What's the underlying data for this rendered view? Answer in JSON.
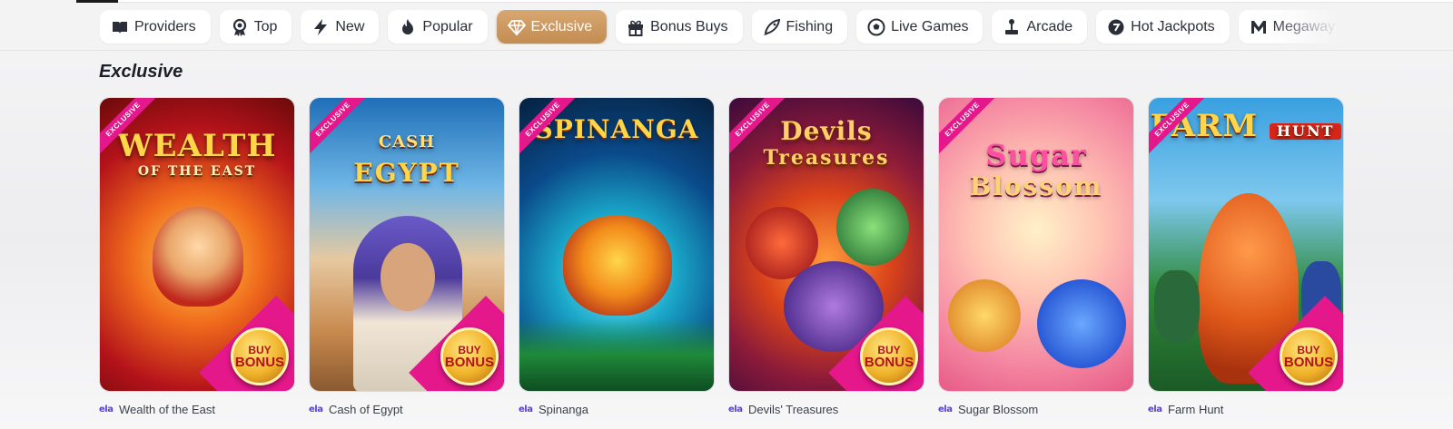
{
  "tabs": [
    {
      "label": "Providers",
      "icon": "book-icon"
    },
    {
      "label": "Top",
      "icon": "award-icon"
    },
    {
      "label": "New",
      "icon": "lightning-icon"
    },
    {
      "label": "Popular",
      "icon": "flame-icon"
    },
    {
      "label": "Exclusive",
      "icon": "diamond-icon",
      "active": true
    },
    {
      "label": "Bonus Buys",
      "icon": "gift-icon"
    },
    {
      "label": "Fishing",
      "icon": "fish-icon"
    },
    {
      "label": "Live Games",
      "icon": "soccer-ball-icon"
    },
    {
      "label": "Arcade",
      "icon": "joystick-icon"
    },
    {
      "label": "Hot Jackpots",
      "icon": "jackpot-icon"
    },
    {
      "label": "Megaway",
      "icon": "megaways-icon"
    }
  ],
  "section": {
    "title": "Exclusive"
  },
  "games": [
    {
      "name": "Wealth of the East",
      "logo": "WEALTH",
      "logo_sub": "OF THE EAST",
      "ribbon": "EXCLUSIVE",
      "badge_top": "BUY",
      "badge_bottom": "BONUS",
      "provider": "ela"
    },
    {
      "name": "Cash of Egypt",
      "logo": "CASH",
      "logo_sub": "EGYPT",
      "ribbon": "EXCLUSIVE",
      "badge_top": "BUY",
      "badge_bottom": "BONUS",
      "provider": "ela"
    },
    {
      "name": "Spinanga",
      "logo": "SPINANGA",
      "logo_sub": "",
      "ribbon": "EXCLUSIVE",
      "badge_top": "",
      "badge_bottom": "",
      "provider": "ela"
    },
    {
      "name": "Devils' Treasures",
      "logo": "Devils",
      "logo_sub": "Treasures",
      "ribbon": "EXCLUSIVE",
      "badge_top": "BUY",
      "badge_bottom": "BONUS",
      "provider": "ela"
    },
    {
      "name": "Sugar Blossom",
      "logo": "Sugar",
      "logo_sub": "Blossom",
      "ribbon": "EXCLUSIVE",
      "badge_top": "",
      "badge_bottom": "",
      "provider": "ela"
    },
    {
      "name": "Farm Hunt",
      "logo": "FARM",
      "logo_sub": "HUNT",
      "ribbon": "EXCLUSIVE",
      "badge_top": "BUY",
      "badge_bottom": "BONUS",
      "provider": "ela"
    }
  ],
  "colors": {
    "active_tab": "#c9945c",
    "ribbon": "#e4178b",
    "provider": "#5a3de0"
  }
}
